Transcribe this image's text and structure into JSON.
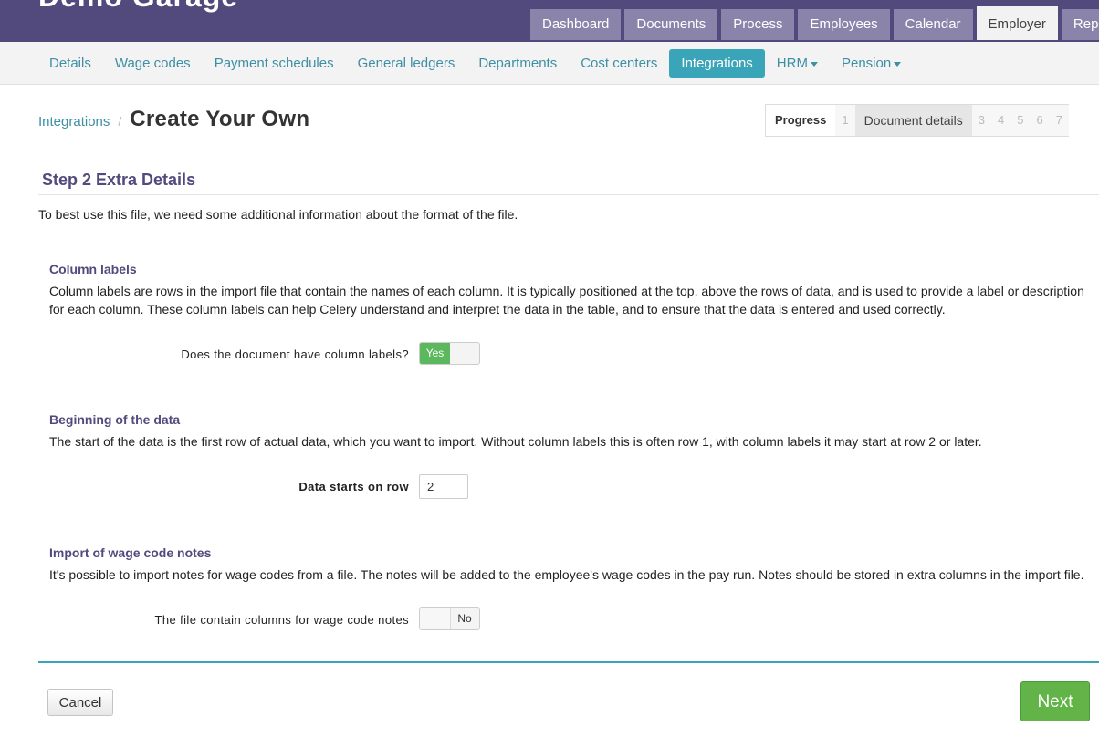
{
  "header": {
    "company": "Demo Garage",
    "main_tabs": [
      {
        "label": "Dashboard"
      },
      {
        "label": "Documents"
      },
      {
        "label": "Process"
      },
      {
        "label": "Employees"
      },
      {
        "label": "Calendar"
      },
      {
        "label": "Employer",
        "active": true
      },
      {
        "label": "Reports"
      }
    ]
  },
  "subnav": {
    "items": [
      {
        "label": "Details"
      },
      {
        "label": "Wage codes"
      },
      {
        "label": "Payment schedules"
      },
      {
        "label": "General ledgers"
      },
      {
        "label": "Departments"
      },
      {
        "label": "Cost centers"
      },
      {
        "label": "Integrations",
        "active": true
      },
      {
        "label": "HRM",
        "dropdown": true
      },
      {
        "label": "Pension",
        "dropdown": true
      }
    ]
  },
  "breadcrumb": {
    "parent": "Integrations",
    "separator": "/",
    "title": "Create Your Own"
  },
  "progress": {
    "label": "Progress",
    "steps": [
      "1",
      "Document details",
      "3",
      "4",
      "5",
      "6",
      "7"
    ],
    "current_index": 1
  },
  "step": {
    "heading": "Step 2 Extra Details",
    "intro": "To best use this file, we need some additional information about the format of the file."
  },
  "sections": {
    "column_labels": {
      "title": "Column labels",
      "description": "Column labels are rows in the import file that contain the names of each column. It is typically positioned at the top, above the rows of data, and is used to provide a label or description for each column. These column labels can help Celery understand and interpret the data in the table, and to ensure that the data is entered and used correctly.",
      "field_label": "Does the document have column labels?",
      "toggle_label": "Yes",
      "toggle_on": true
    },
    "data_start": {
      "title": "Beginning of the data",
      "description": "The start of the data is the first row of actual data, which you want to import. Without column labels this is often row 1, with column labels it may start at row 2 or later.",
      "field_label": "Data starts on row",
      "value": "2"
    },
    "wage_notes": {
      "title": "Import of wage code notes",
      "description": "It's possible to import notes for wage codes from a file. The notes will be added to the employee's wage codes in the pay run. Notes should be stored in extra columns in the import file.",
      "field_label": "The file contain columns for wage code notes",
      "toggle_label": "No",
      "toggle_on": false
    }
  },
  "footer": {
    "cancel_label": "Cancel",
    "next_label": "Next"
  },
  "colors": {
    "header_bg": "#524a7d",
    "accent_teal": "#3aa5b8",
    "toggle_on": "#5cb85c",
    "next_button": "#62b448"
  }
}
